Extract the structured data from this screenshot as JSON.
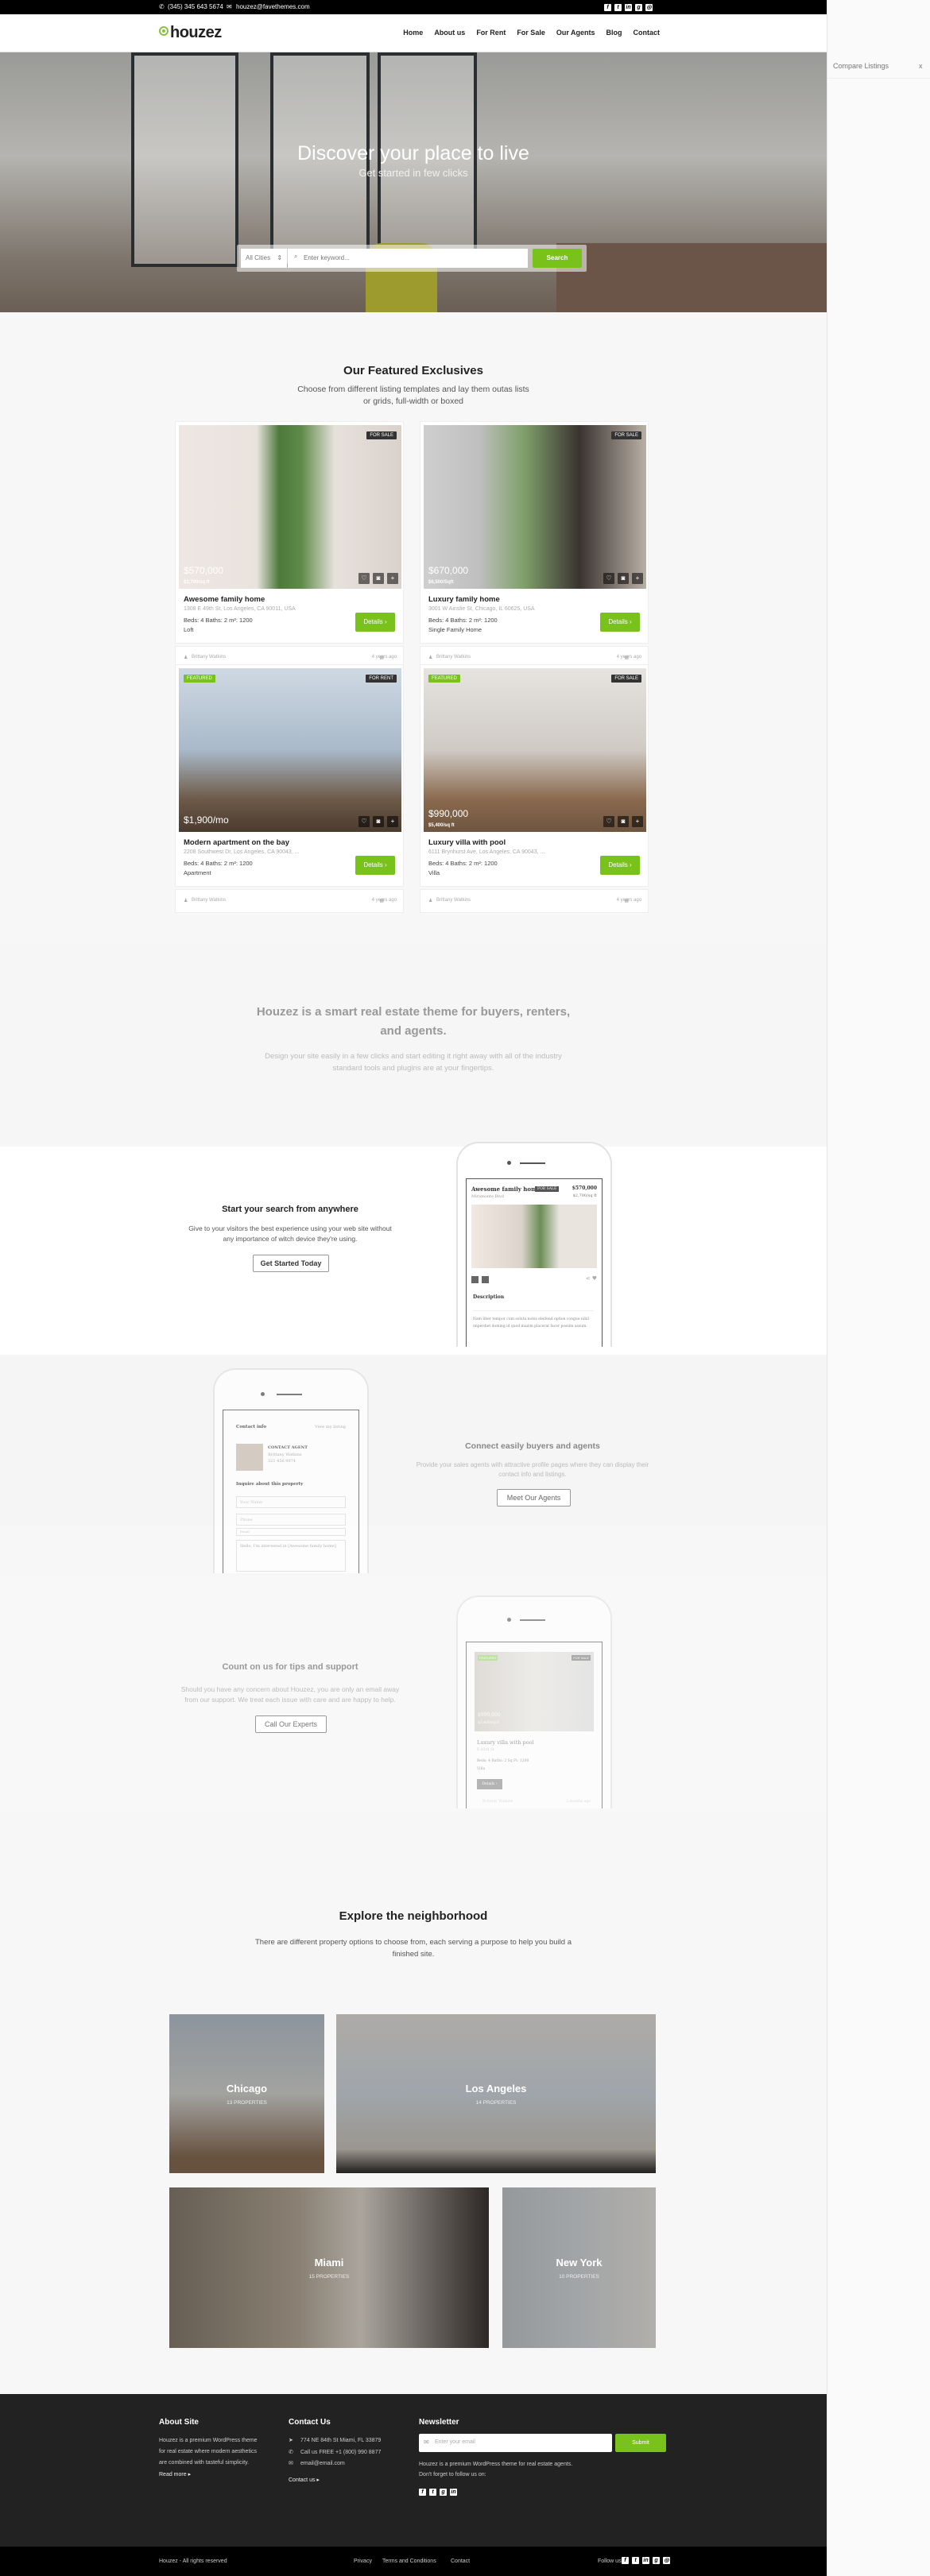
{
  "colors": {
    "accent": "#78c21b",
    "topbar": "#000000",
    "footer": "#222222"
  },
  "topbar": {
    "phone": "(345) 345 643 5674",
    "email": "houzez@favethemes.com",
    "social": [
      "facebook",
      "twitter",
      "linkedin",
      "google-plus",
      "instagram"
    ]
  },
  "header": {
    "logo": "houzez",
    "nav": [
      "Home",
      "About us",
      "For Rent",
      "For Sale",
      "Our Agents",
      "Blog",
      "Contact"
    ]
  },
  "sidebar": {
    "title": "Compare Listings",
    "close": "x"
  },
  "hero": {
    "title": "Discover your place to live",
    "subtitle": "Get started in few clicks",
    "city_select": "All Cities",
    "keyword_placeholder": "Enter keyword...",
    "search_label": "Search"
  },
  "featured": {
    "title": "Our Featured Exclusives",
    "subtitle": "Choose from different listing templates and lay them outas lists or grids, full-width or boxed",
    "listings": [
      {
        "status": "FOR SALE",
        "featured": "",
        "price": "$570,000",
        "price_sqft": "$2,700/sq ft",
        "title": "Awesome family home",
        "address": "1308 E 49th St, Los Angeles, CA 90011, USA",
        "meta": "Beds: 4   Baths: 2   m²: 1200",
        "type": "Loft",
        "details": "Details ›",
        "agent": "Brittany Watkins",
        "date": "4 years ago"
      },
      {
        "status": "FOR SALE",
        "featured": "",
        "price": "$670,000",
        "price_sqft": "$6,500/Sqft",
        "title": "Luxury family home",
        "address": "3001 W Ainslie St, Chicago, IL 60625, USA",
        "meta": "Beds: 4   Baths: 2   m²: 1200",
        "type": "Single Family Home",
        "details": "Details ›",
        "agent": "Brittany Watkins",
        "date": "4 years ago"
      },
      {
        "status": "FOR RENT",
        "featured": "FEATURED",
        "price": "$1,900/mo",
        "price_sqft": "",
        "title": "Modern apartment on the bay",
        "address": "2208 Southwest Dr, Los Angeles, CA 90043, ...",
        "meta": "Beds: 4   Baths: 2   m²: 1200",
        "type": "Apartment",
        "details": "Details ›",
        "agent": "Brittany Watkins",
        "date": "4 years ago"
      },
      {
        "status": "FOR SALE",
        "featured": "FEATURED",
        "price": "$990,000",
        "price_sqft": "$5,400/sq ft",
        "title": "Luxury villa with pool",
        "address": "6111 Brynhurst Ave, Los Angeles, CA 90043, ...",
        "meta": "Beds: 4   Baths: 2   m²: 1200",
        "type": "Villa",
        "details": "Details ›",
        "agent": "Brittany Watkins",
        "date": "4 years ago"
      }
    ]
  },
  "smart": {
    "title": "Houzez is a smart real estate theme for buyers, renters, and agents.",
    "text": "Design your site easily in a few clicks and start editing it right away with all of the industry standard tools and plugins are at your fingertips."
  },
  "feature1": {
    "title": "Start your search from anywhere",
    "text": "Give to your visitors the best experience using your web site without any importance of witch device they're using.",
    "button": "Get Started Today",
    "phone": {
      "title": "Awesome family home",
      "badge": "FOR SALE",
      "street": "Miramonte Blvd",
      "price": "$570,000",
      "price_sqft": "$2,700/sq ft",
      "desc_title": "Description",
      "desc": "Nam liber tempor cum soluta nobis eleifend option congue nihil imperdiet doming id quod mazim placerat facer possim assum."
    }
  },
  "feature2": {
    "title": "Connect easily buyers and agents",
    "text": "Provide your sales agents with attractive profile pages where they can display their contact info and listings.",
    "button": "Meet Our Agents",
    "phone": {
      "contact_info": "Contact info",
      "view_listing": "View my listing",
      "contact_agent": "CONTACT AGENT",
      "agent": "Brittany Watkins",
      "agent_phone": "321 456 9874",
      "inquire": "Inquire about this property",
      "name_ph": "Your Name",
      "phone_ph": "Phone",
      "email_ph": "Email",
      "message": "Hello, I'm interested in [Awesome family home]"
    }
  },
  "feature3": {
    "title": "Count on us for tips and support",
    "text": "Should you have any concern about Houzez, you are only an email away from our support. We treat each issue with care and are happy to help.",
    "button": "Call Our Experts",
    "phone": {
      "featured": "FEATURED",
      "status": "FOR SALE",
      "price": "$990,000",
      "price_sqft": "$5,400/sq ft",
      "title": "Luxury villa with pool",
      "street": "E 83rd St",
      "meta": "Beds: 4   Baths: 2   Sq Ft: 1200",
      "type": "Villa",
      "details": "Details ›",
      "agent": "Brittany Watkins",
      "date": "3 months ago"
    }
  },
  "neighborhood": {
    "title": "Explore the neighborhood",
    "subtitle": "There are different property options to choose from, each serving a purpose to help you build a finished site.",
    "cities": [
      {
        "name": "Chicago",
        "count": "13 PROPERTIES"
      },
      {
        "name": "Los Angeles",
        "count": "14 PROPERTIES"
      },
      {
        "name": "Miami",
        "count": "15 PROPERTIES"
      },
      {
        "name": "New York",
        "count": "10 PROPERTIES"
      }
    ]
  },
  "footer": {
    "about": {
      "title": "About Site",
      "text": "Houzez is a premium WordPress theme for real estate where modern aesthetics are combined with tasteful simplicity.",
      "link": "Read more ▸"
    },
    "contact": {
      "title": "Contact Us",
      "address": "774 NE 84th St Miami, FL 33879",
      "phone": "Call us FREE +1 (800) 990 8877",
      "email": "email@email.com",
      "link": "Contact us ▸"
    },
    "newsletter": {
      "title": "Newsletter",
      "placeholder": "Enter your email",
      "submit": "Submit",
      "text1": "Houzez is a premium WordPress theme for real estate agents.",
      "text2": "Don't forget to follow us on:",
      "social": [
        "facebook",
        "twitter",
        "google-plus",
        "linkedin"
      ]
    }
  },
  "bottom": {
    "copyright": "Houzez - All rights reserved",
    "links": [
      "Privacy",
      "Terms and Conditions",
      "Contact"
    ],
    "follow": "Follow us"
  }
}
